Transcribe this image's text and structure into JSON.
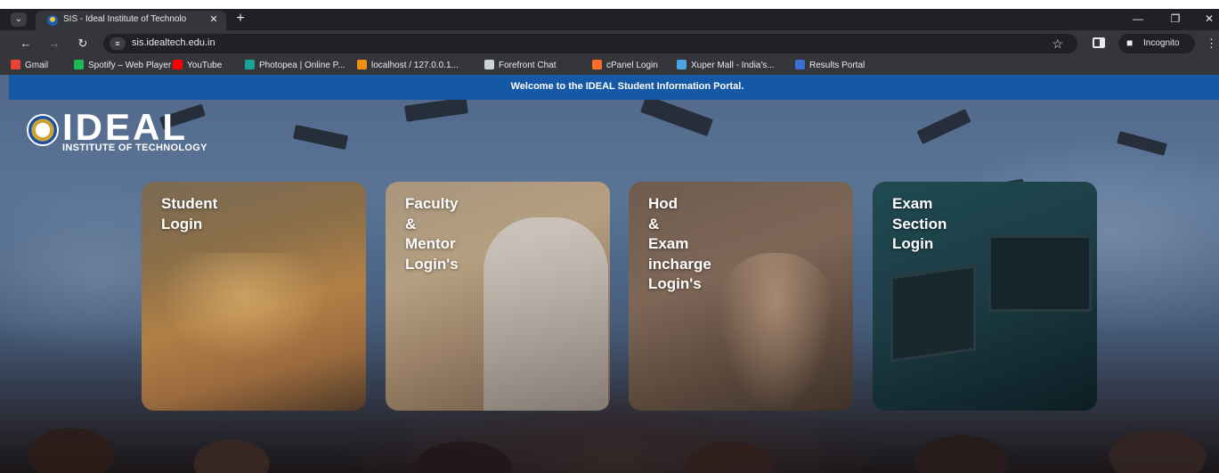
{
  "browser": {
    "tab": {
      "title": "SIS - Ideal Institute of Technolo"
    },
    "url": "sis.idealtech.edu.in",
    "incognito_label": "Incognito",
    "bookmarks": [
      {
        "label": "Gmail",
        "icon": "gmail-icon",
        "color": "#ea4335"
      },
      {
        "label": "Spotify – Web Player",
        "icon": "spotify-icon",
        "color": "#1db954"
      },
      {
        "label": "YouTube",
        "icon": "youtube-icon",
        "color": "#ff0000"
      },
      {
        "label": "Photopea | Online P...",
        "icon": "photopea-icon",
        "color": "#18a497"
      },
      {
        "label": "localhost / 127.0.0.1...",
        "icon": "phpmyadmin-icon",
        "color": "#f29111"
      },
      {
        "label": "Forefront Chat",
        "icon": "forefront-icon",
        "color": "#cfd2d6"
      },
      {
        "label": "cPanel Login",
        "icon": "cpanel-icon",
        "color": "#ff6c2c"
      },
      {
        "label": "Xuper Mall - India's...",
        "icon": "xuper-icon",
        "color": "#4fa3e3"
      },
      {
        "label": "Results Portal",
        "icon": "results-portal-icon",
        "color": "#3b6fd1"
      }
    ]
  },
  "page": {
    "banner": "Welcome to the IDEAL Student Information Portal.",
    "banner_color": "#1458a6",
    "logo": {
      "word": "IDEAL",
      "subtitle": "INSTITUTE OF TECHNOLOGY"
    },
    "cards": [
      {
        "label": "Student\nLogin"
      },
      {
        "label": "Faculty\n&\nMentor\nLogin's"
      },
      {
        "label": "Hod\n&\nExam\nincharge\nLogin's"
      },
      {
        "label": "Exam\nSection\nLogin"
      }
    ]
  }
}
